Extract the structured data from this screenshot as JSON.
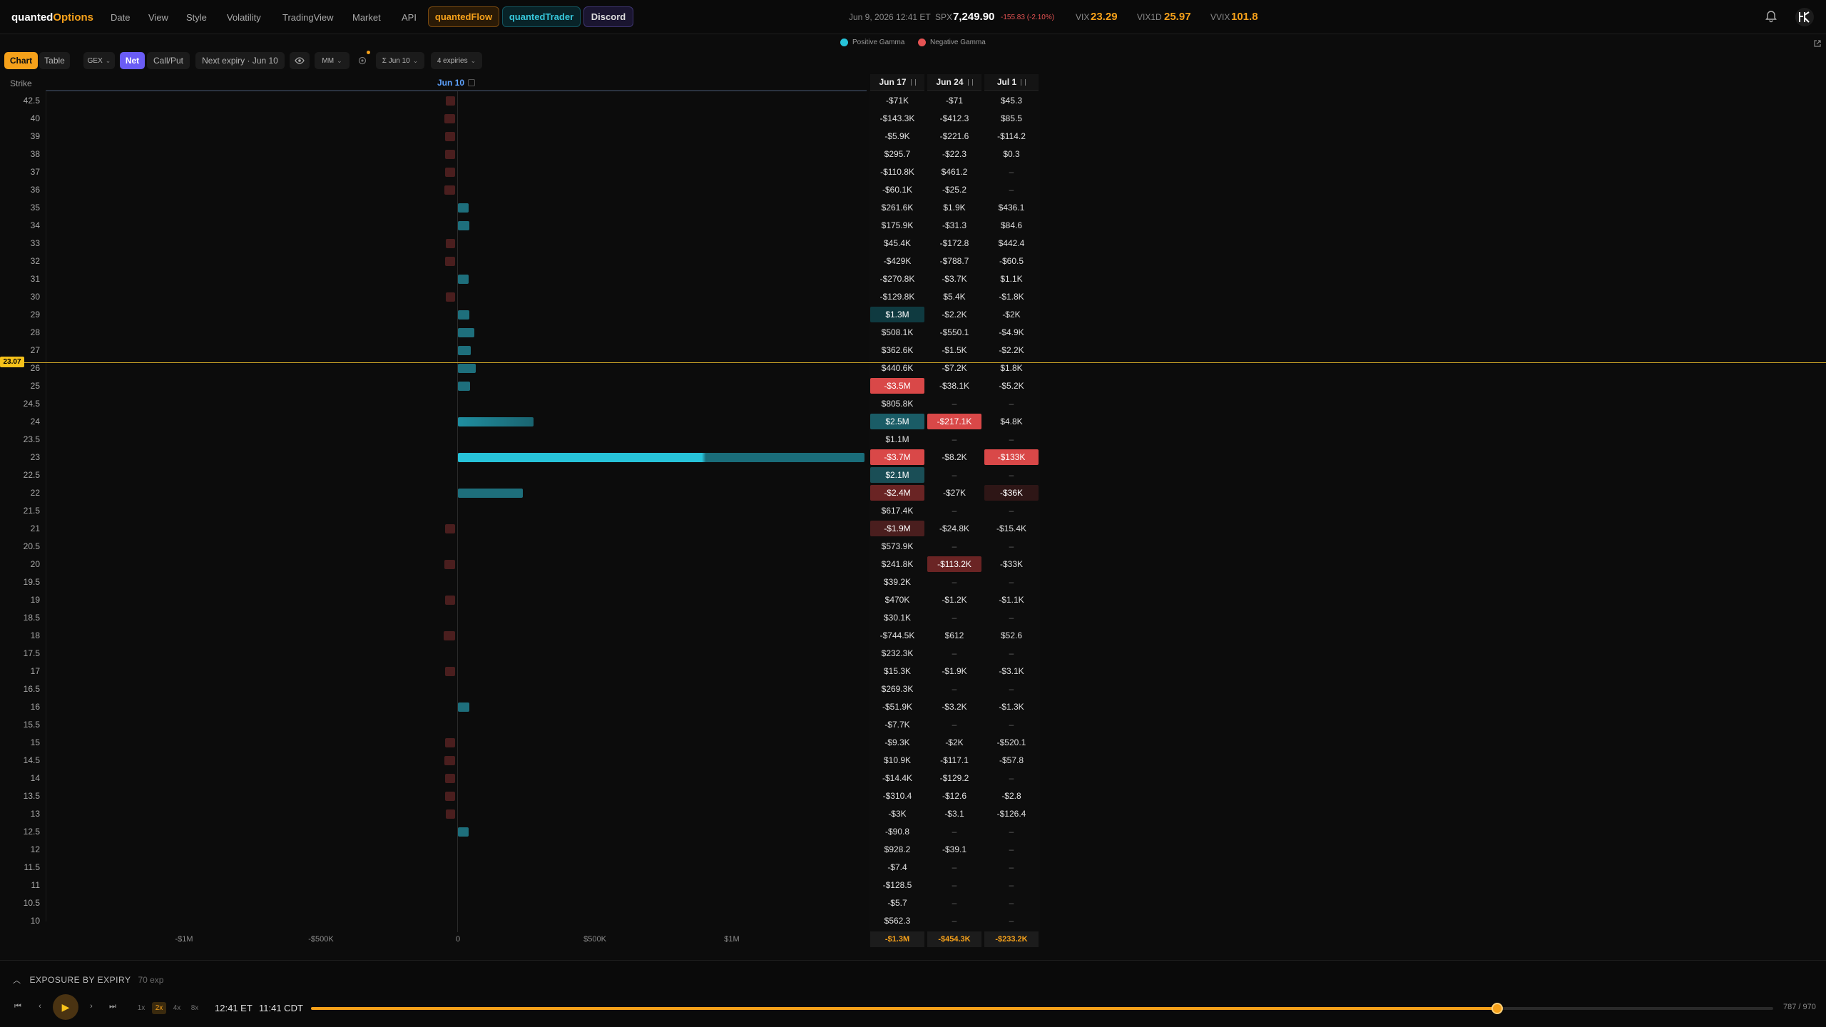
{
  "app": {
    "logo_main": "quanted",
    "logo_accent": "Options"
  },
  "nav": [
    "Date",
    "View",
    "Style",
    "Volatility",
    "TradingView",
    "Market",
    "API"
  ],
  "pills": {
    "flow": "quantedFlow",
    "trader": "quantedTrader",
    "discord": "Discord"
  },
  "market": {
    "timestamp": "Jun 9, 2026 12:41 ET",
    "spx_label": "SPX",
    "spx_value": "7,249.90",
    "spx_change": "-155.83 (-2.10%)",
    "vix_label": "VIX",
    "vix_value": "23.29",
    "vix1d_label": "VIX1D",
    "vix1d_value": "25.97",
    "vvix_label": "VVIX",
    "vvix_value": "101.8"
  },
  "legend": {
    "positive": "Positive Gamma",
    "negative": "Negative Gamma"
  },
  "controls": {
    "chart": "Chart",
    "table": "Table",
    "gex": "GEX",
    "net": "Net",
    "callput": "Call/Put",
    "next_expiry": "Next expiry · Jun 10",
    "mm": "MM",
    "sum_expiry": "Σ Jun 10",
    "expiries": "4 expiries"
  },
  "colors": {
    "positive": "#1ea0b4",
    "negative": "#d94848",
    "accent": "#f6a11a"
  },
  "icons": [
    "bell-icon",
    "user-avatar-icon",
    "eye-icon",
    "settings-icon",
    "external-link-icon",
    "play-icon",
    "skip-start-icon",
    "step-back-icon",
    "step-forward-icon",
    "skip-end-icon",
    "chevron-down-icon",
    "chevron-up-icon",
    "reorder-icon"
  ],
  "chart_header": {
    "strike": "Strike",
    "expiry": "Jun 10"
  },
  "current_price": "23.07",
  "xticks": [
    "-$1M",
    "-$500K",
    "0",
    "$500K",
    "$1M"
  ],
  "chart_data": {
    "type": "bar",
    "orientation": "horizontal",
    "xlim": [
      -1500000,
      1500000
    ],
    "series": [
      {
        "name": "Positive Gamma"
      },
      {
        "name": "Negative Gamma"
      }
    ],
    "strikes": [
      "42.5",
      "40",
      "39",
      "38",
      "37",
      "36",
      "35",
      "34",
      "33",
      "32",
      "31",
      "30",
      "29",
      "28",
      "27",
      "26",
      "25",
      "24.5",
      "24",
      "23.5",
      "23",
      "22.5",
      "22",
      "21.5",
      "21",
      "20.5",
      "20",
      "19.5",
      "19",
      "18.5",
      "18",
      "17.5",
      "17",
      "16.5",
      "16",
      "15.5",
      "15",
      "14.5",
      "14",
      "13.5",
      "13",
      "12.5",
      "12",
      "11.5",
      "11",
      "10.5",
      "10"
    ],
    "values": [
      -35000,
      -40000,
      -38000,
      -36000,
      -38000,
      -40000,
      40000,
      42000,
      -35000,
      -38000,
      40000,
      -35000,
      42000,
      60000,
      48000,
      65000,
      45000,
      0,
      280000,
      0,
      1500000,
      0,
      240000,
      0,
      -38000,
      0,
      -40000,
      0,
      -38000,
      0,
      -42000,
      0,
      -38000,
      0,
      42000,
      0,
      -38000,
      -40000,
      -38000,
      -36000,
      -35000,
      40000,
      0,
      0,
      0,
      0,
      0
    ]
  },
  "table": {
    "columns": [
      "Jun 17",
      "Jun 24",
      "Jul 1"
    ],
    "rows": [
      [
        "-$71K",
        "-$71",
        "$45.3"
      ],
      [
        "-$143.3K",
        "-$412.3",
        "$85.5"
      ],
      [
        "-$5.9K",
        "-$221.6",
        "-$114.2"
      ],
      [
        "$295.7",
        "-$22.3",
        "$0.3"
      ],
      [
        "-$110.8K",
        "$461.2",
        "–"
      ],
      [
        "-$60.1K",
        "-$25.2",
        "–"
      ],
      [
        "$261.6K",
        "$1.9K",
        "$436.1"
      ],
      [
        "$175.9K",
        "-$31.3",
        "$84.6"
      ],
      [
        "$45.4K",
        "-$172.8",
        "$442.4"
      ],
      [
        "-$429K",
        "-$788.7",
        "-$60.5"
      ],
      [
        "-$270.8K",
        "-$3.7K",
        "$1.1K"
      ],
      [
        "-$129.8K",
        "$5.4K",
        "-$1.8K"
      ],
      [
        "$1.3M",
        "-$2.2K",
        "-$2K"
      ],
      [
        "$508.1K",
        "-$550.1",
        "-$4.9K"
      ],
      [
        "$362.6K",
        "-$1.5K",
        "-$2.2K"
      ],
      [
        "$440.6K",
        "-$7.2K",
        "$1.8K"
      ],
      [
        "-$3.5M",
        "-$38.1K",
        "-$5.2K"
      ],
      [
        "$805.8K",
        "–",
        "–"
      ],
      [
        "$2.5M",
        "-$217.1K",
        "$4.8K"
      ],
      [
        "$1.1M",
        "–",
        "–"
      ],
      [
        "-$3.7M",
        "-$8.2K",
        "-$133K"
      ],
      [
        "$2.1M",
        "–",
        "–"
      ],
      [
        "-$2.4M",
        "-$27K",
        "-$36K"
      ],
      [
        "$617.4K",
        "–",
        "–"
      ],
      [
        "-$1.9M",
        "-$24.8K",
        "-$15.4K"
      ],
      [
        "$573.9K",
        "–",
        "–"
      ],
      [
        "$241.8K",
        "-$113.2K",
        "-$33K"
      ],
      [
        "$39.2K",
        "–",
        "–"
      ],
      [
        "$470K",
        "-$1.2K",
        "-$1.1K"
      ],
      [
        "$30.1K",
        "–",
        "–"
      ],
      [
        "-$744.5K",
        "$612",
        "$52.6"
      ],
      [
        "$232.3K",
        "–",
        "–"
      ],
      [
        "$15.3K",
        "-$1.9K",
        "-$3.1K"
      ],
      [
        "$269.3K",
        "–",
        "–"
      ],
      [
        "-$51.9K",
        "-$3.2K",
        "-$1.3K"
      ],
      [
        "-$7.7K",
        "–",
        "–"
      ],
      [
        "-$9.3K",
        "-$2K",
        "-$520.1"
      ],
      [
        "$10.9K",
        "-$117.1",
        "-$57.8"
      ],
      [
        "-$14.4K",
        "-$129.2",
        "–"
      ],
      [
        "-$310.4",
        "-$12.6",
        "-$2.8"
      ],
      [
        "-$3K",
        "-$3.1",
        "-$126.4"
      ],
      [
        "-$90.8",
        "–",
        "–"
      ],
      [
        "$928.2",
        "-$39.1",
        "–"
      ],
      [
        "-$7.4",
        "–",
        "–"
      ],
      [
        "-$128.5",
        "–",
        "–"
      ],
      [
        "-$5.7",
        "–",
        "–"
      ],
      [
        "$562.3",
        "–",
        "–"
      ]
    ],
    "totals": [
      "-$1.3M",
      "-$454.3K",
      "-$233.2K"
    ]
  },
  "bottom": {
    "title": "EXPOSURE BY EXPIRY",
    "count": "70 exp",
    "speeds": [
      "1x",
      "2x",
      "4x",
      "8x"
    ],
    "time_et": "12:41 ET",
    "time_cdt": "11:41 CDT",
    "frame": "787 / 970",
    "progress": 0.811
  }
}
